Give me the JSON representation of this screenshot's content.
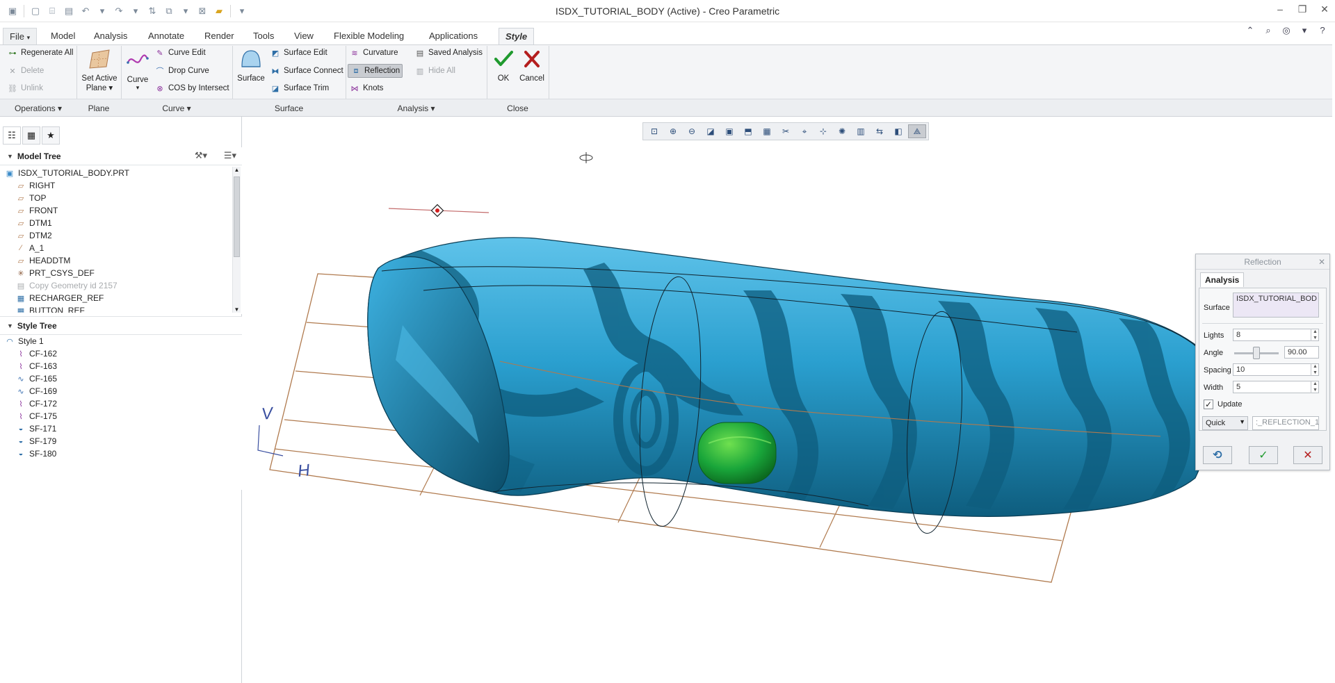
{
  "window": {
    "title": "ISDX_TUTORIAL_BODY (Active) - Creo Parametric"
  },
  "tabs": [
    {
      "label": "File",
      "arrow": "▾"
    },
    {
      "label": "Model"
    },
    {
      "label": "Analysis"
    },
    {
      "label": "Annotate"
    },
    {
      "label": "Render"
    },
    {
      "label": "Tools"
    },
    {
      "label": "View"
    },
    {
      "label": "Flexible Modeling"
    },
    {
      "label": "Applications"
    },
    {
      "label": "Style"
    }
  ],
  "ribbon": {
    "operations": {
      "regenerate_all": "Regenerate All",
      "delete": "Delete",
      "unlink": "Unlink",
      "group_label": "Operations"
    },
    "plane": {
      "set_active_plane_line1": "Set Active",
      "set_active_plane_line2": "Plane",
      "group_label": "Plane"
    },
    "curve": {
      "curve": "Curve",
      "curve_edit": "Curve Edit",
      "drop_curve": "Drop Curve",
      "cos_by_intersect": "COS by Intersect",
      "group_label": "Curve"
    },
    "surface": {
      "surface": "Surface",
      "surface_edit": "Surface Edit",
      "surface_connect": "Surface Connect",
      "surface_trim": "Surface Trim",
      "group_label": "Surface"
    },
    "analysis": {
      "curvature": "Curvature",
      "reflection": "Reflection",
      "knots": "Knots",
      "saved_analysis": "Saved Analysis",
      "hide_all": "Hide All",
      "group_label": "Analysis"
    },
    "close": {
      "ok": "OK",
      "cancel": "Cancel",
      "group_label": "Close"
    }
  },
  "model_tree": {
    "title": "Model Tree",
    "items": [
      {
        "label": "ISDX_TUTORIAL_BODY.PRT",
        "icon": "part-icon"
      },
      {
        "label": "RIGHT",
        "icon": "datum-plane-icon"
      },
      {
        "label": "TOP",
        "icon": "datum-plane-icon"
      },
      {
        "label": "FRONT",
        "icon": "datum-plane-icon"
      },
      {
        "label": "DTM1",
        "icon": "datum-plane-icon"
      },
      {
        "label": "DTM2",
        "icon": "datum-plane-icon"
      },
      {
        "label": "A_1",
        "icon": "datum-axis-icon"
      },
      {
        "label": "HEADDTM",
        "icon": "datum-plane-icon"
      },
      {
        "label": "PRT_CSYS_DEF",
        "icon": "csys-icon"
      },
      {
        "label": "Copy Geometry id 2157",
        "icon": "copy-geometry-icon"
      },
      {
        "label": "RECHARGER_REF",
        "icon": "reference-icon"
      },
      {
        "label": "BUTTON_REF",
        "icon": "reference-icon"
      }
    ]
  },
  "style_tree": {
    "title": "Style Tree",
    "items": [
      {
        "label": "Style 1",
        "icon": "style-feature-icon"
      },
      {
        "label": "CF-162",
        "icon": "free-curve-icon"
      },
      {
        "label": "CF-163",
        "icon": "free-curve-icon"
      },
      {
        "label": "CF-165",
        "icon": "planar-curve-icon"
      },
      {
        "label": "CF-169",
        "icon": "planar-curve-icon"
      },
      {
        "label": "CF-172",
        "icon": "free-curve-icon"
      },
      {
        "label": "CF-175",
        "icon": "free-curve-icon"
      },
      {
        "label": "SF-171",
        "icon": "style-surface-icon"
      },
      {
        "label": "SF-179",
        "icon": "style-surface-icon"
      },
      {
        "label": "SF-180",
        "icon": "style-surface-icon"
      }
    ]
  },
  "viewport": {
    "axis_v": "V",
    "axis_h": "H"
  },
  "reflection_dialog": {
    "title": "Reflection",
    "tab": "Analysis",
    "surface_label": "Surface",
    "surface_value": "ISDX_TUTORIAL_BOD",
    "lights_label": "Lights",
    "lights_value": "8",
    "angle_label": "Angle",
    "angle_value": "90.00",
    "angle_slider_fraction": 0.5,
    "spacing_label": "Spacing",
    "spacing_value": "10",
    "width_label": "Width",
    "width_value": "5",
    "update_label": "Update",
    "update_checked": true,
    "mode_value": "Quick",
    "name_value": ":_REFLECTION_1"
  },
  "colors": {
    "surface_light": "#5fc3ea",
    "surface_dark": "#0e5d7e",
    "plane_grid": "#b07a4e",
    "button_green": "#19a53a",
    "ok_check": "#1f9a2e",
    "cancel_x": "#b41e1e"
  }
}
